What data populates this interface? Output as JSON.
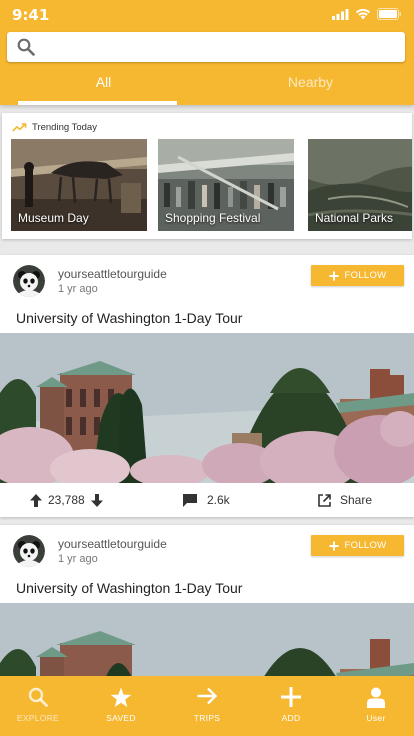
{
  "status": {
    "time": "9:41"
  },
  "search": {
    "placeholder": ""
  },
  "tabs": [
    {
      "label": "All"
    },
    {
      "label": "Nearby"
    }
  ],
  "trending": {
    "title": "Trending Today",
    "items": [
      {
        "label": "Museum Day"
      },
      {
        "label": "Shopping Festival"
      },
      {
        "label": "National Parks"
      }
    ]
  },
  "posts": [
    {
      "user": "yourseattletourguide",
      "ago": "1 yr ago",
      "follow": "FOLLOW",
      "title": "University of Washington 1-Day Tour",
      "votes": "23,788",
      "comments": "2.6k",
      "share": "Share"
    },
    {
      "user": "yourseattletourguide",
      "ago": "1 yr ago",
      "follow": "FOLLOW",
      "title": "University of Washington 1-Day Tour"
    }
  ],
  "nav": [
    {
      "label": "EXPLORE",
      "icon": "search-icon"
    },
    {
      "label": "SAVED",
      "icon": "star-icon"
    },
    {
      "label": "TRIPS",
      "icon": "arrow-right-icon"
    },
    {
      "label": "ADD",
      "icon": "plus-icon"
    },
    {
      "label": "User",
      "icon": "user-icon"
    }
  ],
  "colors": {
    "accent": "#f6b731",
    "active_nav": "#ffffff"
  }
}
